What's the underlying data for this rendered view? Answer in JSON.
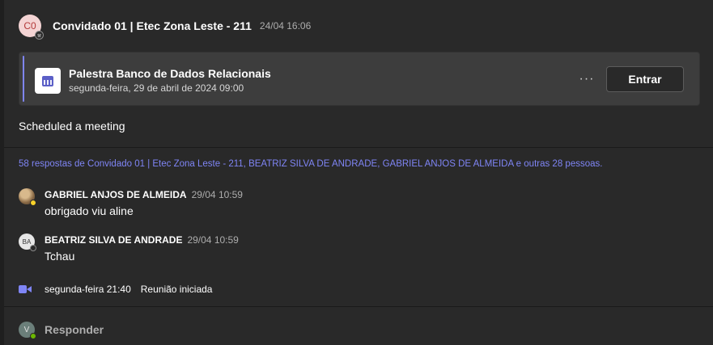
{
  "post": {
    "avatar_initials": "C0",
    "sender": "Convidado 01 | Etec Zona Leste - 211",
    "time": "24/04 16:06"
  },
  "meeting_card": {
    "title": "Palestra Banco de Dados Relacionais",
    "date": "segunda-feira, 29 de abril de 2024 09:00",
    "more_label": "···",
    "join_label": "Entrar",
    "accent_color": "#7f85f5",
    "icon": "calendar-icon"
  },
  "message": "Scheduled a meeting",
  "replies_summary": "58 respostas de Convidado 01 | Etec Zona Leste - 211, BEATRIZ SILVA DE ANDRADE, GABRIEL ANJOS DE ALMEIDA e outras 28 pessoas.",
  "replies": [
    {
      "name": "GABRIEL ANJOS DE ALMEIDA",
      "time": "29/04 10:59",
      "text": "obrigado viu aline",
      "presence_color": "#f8d22a"
    },
    {
      "name": "BEATRIZ SILVA DE ANDRADE",
      "initials": "BA",
      "time": "29/04 10:59",
      "text": "Tchau"
    }
  ],
  "event": {
    "icon": "video-icon",
    "time": "segunda-feira 21:40",
    "text": "Reunião iniciada"
  },
  "reply_bar": {
    "avatar_initials": "V",
    "label": "Responder",
    "presence_color": "#6bb700"
  }
}
